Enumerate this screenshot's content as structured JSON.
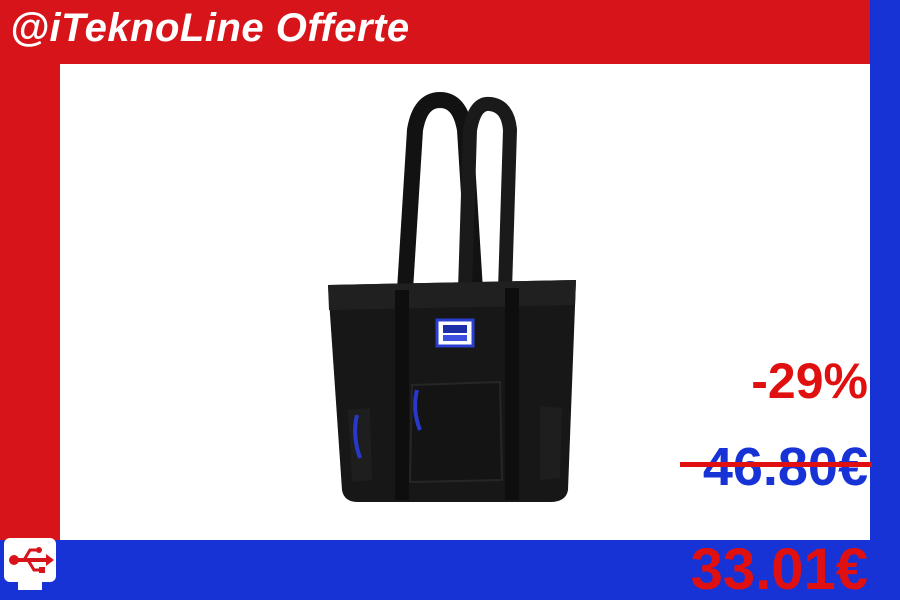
{
  "brand": {
    "title": "@iTeknoLine Offerte"
  },
  "product": {
    "image_icon": "tote-bag-image"
  },
  "pricing": {
    "discount": "-29%",
    "old_price": "46.80€",
    "new_price": "33.01€"
  },
  "logo": {
    "icon": "usb-monitor-icon"
  },
  "colors": {
    "red": "#d7141a",
    "blue": "#1733d6",
    "price_red": "#e01010"
  }
}
